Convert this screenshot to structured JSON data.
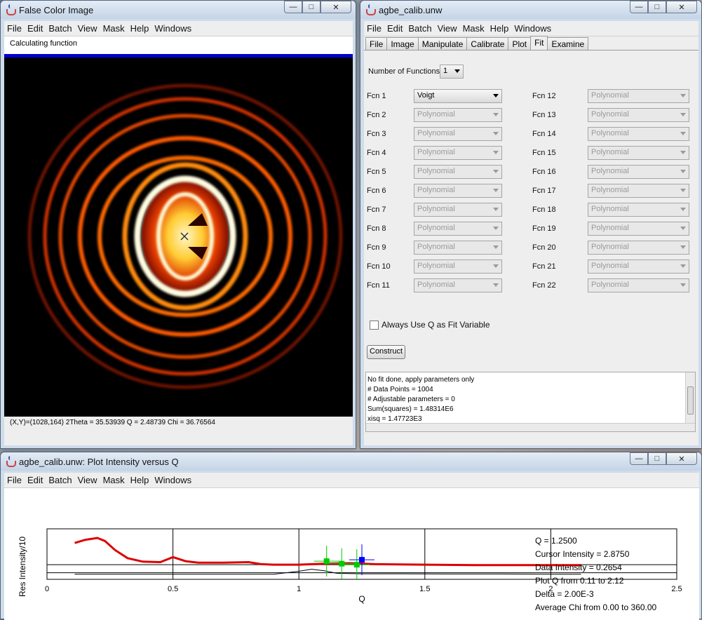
{
  "colors": {
    "accent": "#0000cc",
    "image_bg": "#000000",
    "ring": "#ff6a00",
    "plot_red": "#dd0000",
    "marker_green": "#00cc00",
    "marker_blue": "#0000ff"
  },
  "false_color": {
    "title": "False Color Image",
    "menu": [
      "File",
      "Edit",
      "Batch",
      "View",
      "Mask",
      "Help",
      "Windows"
    ],
    "status": "Calculating function",
    "coords": "(X,Y)=(1028,164)  2Theta = 35.53939 Q = 2.48739 Chi = 36.76564"
  },
  "calib": {
    "title": "agbe_calib.unw",
    "menu": [
      "File",
      "Edit",
      "Batch",
      "View",
      "Mask",
      "Help",
      "Windows"
    ],
    "tabs": [
      "File",
      "Image",
      "Manipulate",
      "Calibrate",
      "Plot",
      "Fit",
      "Examine"
    ],
    "active_tab": "Fit",
    "num_functions_label": "Number of Functions",
    "num_functions_value": "1",
    "fn_left": [
      {
        "label": "Fcn 1",
        "value": "Voigt"
      },
      {
        "label": "Fcn 2",
        "value": "Polynomial"
      },
      {
        "label": "Fcn 3",
        "value": "Polynomial"
      },
      {
        "label": "Fcn 4",
        "value": "Polynomial"
      },
      {
        "label": "Fcn 5",
        "value": "Polynomial"
      },
      {
        "label": "Fcn 6",
        "value": "Polynomial"
      },
      {
        "label": "Fcn 7",
        "value": "Polynomial"
      },
      {
        "label": "Fcn 8",
        "value": "Polynomial"
      },
      {
        "label": "Fcn 9",
        "value": "Polynomial"
      },
      {
        "label": "Fcn 10",
        "value": "Polynomial"
      },
      {
        "label": "Fcn 11",
        "value": "Polynomial"
      }
    ],
    "fn_right": [
      {
        "label": "Fcn 12",
        "value": "Polynomial"
      },
      {
        "label": "Fcn 13",
        "value": "Polynomial"
      },
      {
        "label": "Fcn 14",
        "value": "Polynomial"
      },
      {
        "label": "Fcn 15",
        "value": "Polynomial"
      },
      {
        "label": "Fcn 16",
        "value": "Polynomial"
      },
      {
        "label": "Fcn 17",
        "value": "Polynomial"
      },
      {
        "label": "Fcn 18",
        "value": "Polynomial"
      },
      {
        "label": "Fcn 19",
        "value": "Polynomial"
      },
      {
        "label": "Fcn 20",
        "value": "Polynomial"
      },
      {
        "label": "Fcn 21",
        "value": "Polynomial"
      },
      {
        "label": "Fcn 22",
        "value": "Polynomial"
      }
    ],
    "always_q_label": "Always Use Q as Fit Variable",
    "construct_label": "Construct",
    "output_lines": [
      "No fit done, apply parameters only",
      "# Data Points = 1004",
      "# Adjustable parameters = 0",
      "Sum(squares) =    1.48314E6",
      "xisq =    1.47723E3"
    ]
  },
  "plot_window": {
    "title": "agbe_calib.unw: Plot Intensity versus Q",
    "menu": [
      "File",
      "Edit",
      "Batch",
      "View",
      "Mask",
      "Help",
      "Windows"
    ],
    "x_axis_label": "Q",
    "y_axis_label": "Res Intensity/10",
    "x_ticks": [
      "0",
      "0.5",
      "1",
      "1.5",
      "2",
      "2.5"
    ],
    "readout": [
      "Q = 1.2500",
      "Cursor Intensity = 2.8750",
      "Data Intensity = 0.2654",
      "Plot Q from 0.11 to 2.12",
      "Delta = 2.00E-3",
      "Average Chi from 0.00 to 360.00"
    ]
  },
  "chart_data": {
    "type": "line",
    "title": "",
    "xlabel": "Q",
    "ylabel": "Res Intensity/10",
    "xlim": [
      0,
      2.5
    ],
    "x_ticks": [
      0,
      0.5,
      1,
      1.5,
      2,
      2.5
    ],
    "series": [
      {
        "name": "",
        "color": "#dd0000",
        "x": [
          0.11,
          0.15,
          0.2,
          0.23,
          0.27,
          0.32,
          0.38,
          0.45,
          0.5,
          0.55,
          0.6,
          0.7,
          0.8,
          0.85,
          0.9,
          1.0,
          1.1,
          1.2,
          1.3,
          1.5,
          1.7,
          1.9,
          2.12
        ],
        "y": [
          6.2,
          6.8,
          7.2,
          6.6,
          4.8,
          3.2,
          2.5,
          2.4,
          3.4,
          2.6,
          2.3,
          2.3,
          2.4,
          2.0,
          1.9,
          1.9,
          2.1,
          2.2,
          2.0,
          1.9,
          1.8,
          1.8,
          1.8
        ]
      },
      {
        "name": "",
        "color": "#000000",
        "x": [
          0.11,
          0.5,
          0.9,
          1.0,
          1.05,
          1.1,
          1.15,
          1.25,
          1.4,
          1.6,
          1.8,
          2.0,
          2.12
        ],
        "y": [
          0.0,
          0.0,
          0.0,
          0.6,
          1.0,
          0.7,
          0.2,
          0.1,
          0.1,
          0.05,
          0.05,
          0.0,
          0.0
        ]
      }
    ],
    "markers": [
      {
        "q": 1.11,
        "y": 2.6,
        "color": "#00cc00"
      },
      {
        "q": 1.17,
        "y": 2.1,
        "color": "#00cc00"
      },
      {
        "q": 1.23,
        "y": 1.9,
        "color": "#00cc00"
      },
      {
        "q": 1.25,
        "y": 2.875,
        "color": "#0000ff"
      }
    ]
  }
}
